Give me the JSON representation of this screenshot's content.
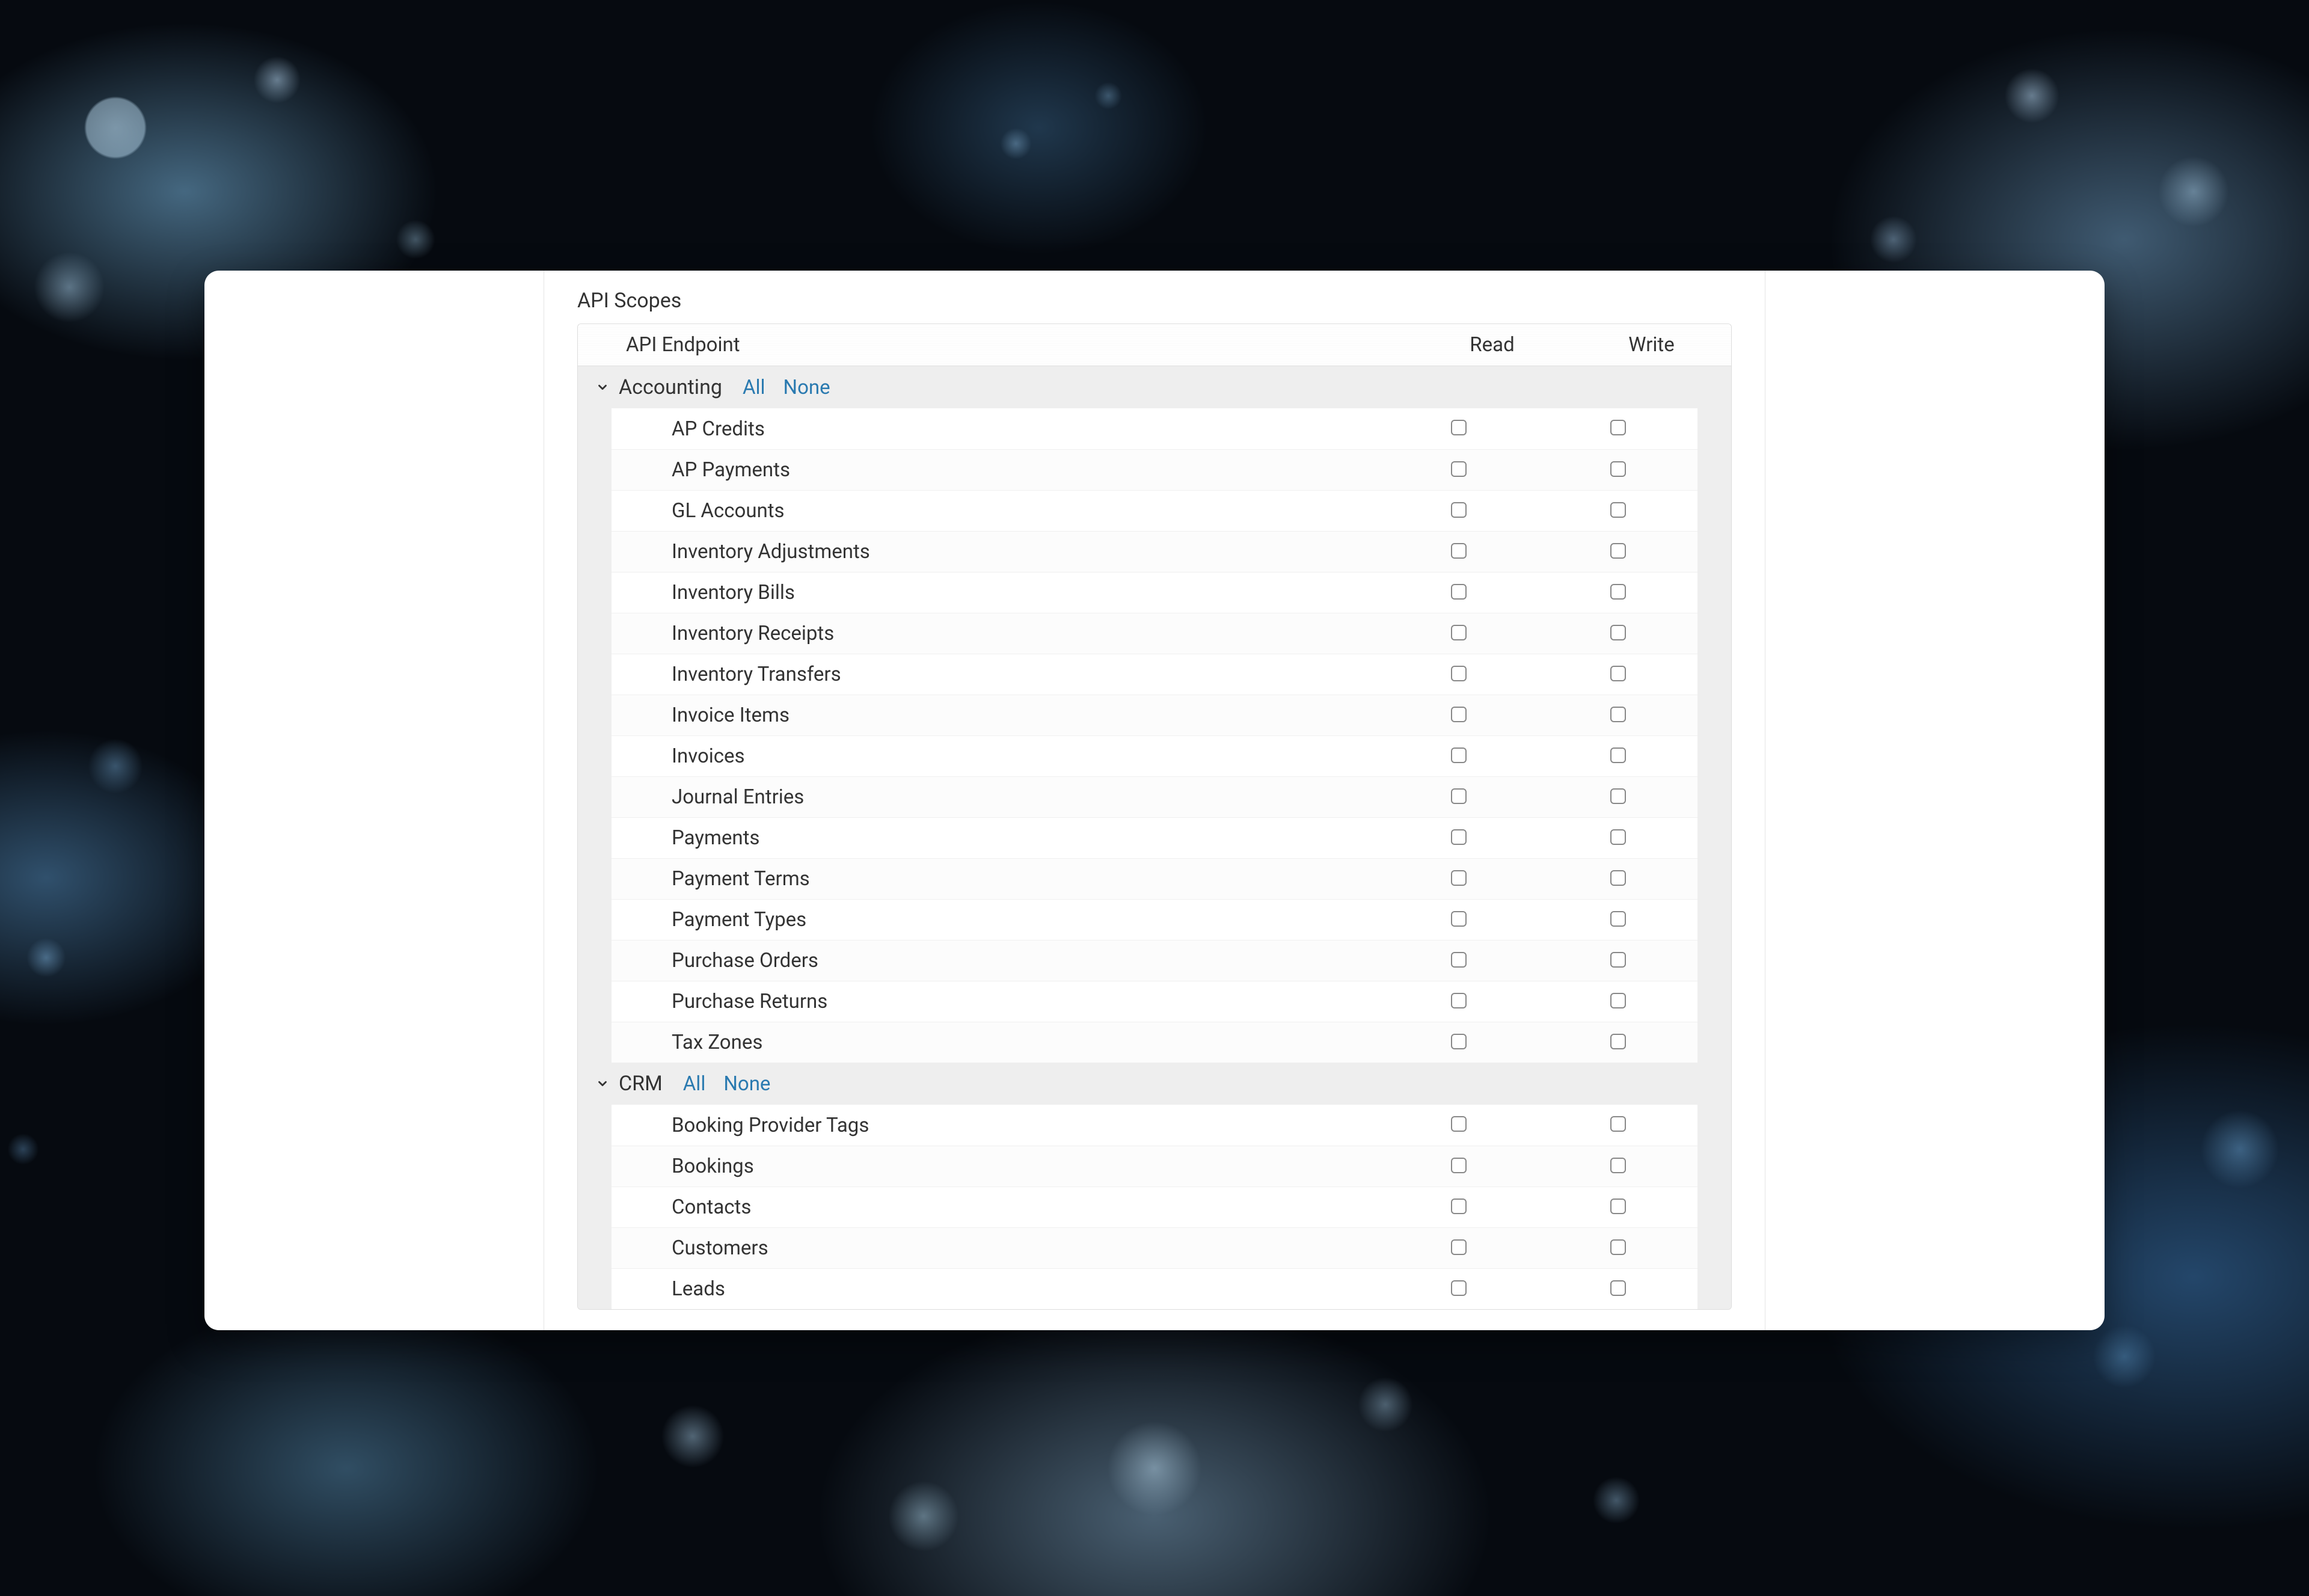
{
  "section_title": "API Scopes",
  "columns": {
    "endpoint": "API Endpoint",
    "read": "Read",
    "write": "Write"
  },
  "link_all": "All",
  "link_none": "None",
  "groups": [
    {
      "name": "Accounting",
      "expanded": true,
      "items": [
        {
          "label": "AP Credits",
          "read": false,
          "write": false
        },
        {
          "label": "AP Payments",
          "read": false,
          "write": false
        },
        {
          "label": "GL Accounts",
          "read": false,
          "write": false
        },
        {
          "label": "Inventory Adjustments",
          "read": false,
          "write": false
        },
        {
          "label": "Inventory Bills",
          "read": false,
          "write": false
        },
        {
          "label": "Inventory Receipts",
          "read": false,
          "write": false
        },
        {
          "label": "Inventory Transfers",
          "read": false,
          "write": false
        },
        {
          "label": "Invoice Items",
          "read": false,
          "write": false
        },
        {
          "label": "Invoices",
          "read": false,
          "write": false
        },
        {
          "label": "Journal Entries",
          "read": false,
          "write": false
        },
        {
          "label": "Payments",
          "read": false,
          "write": false
        },
        {
          "label": "Payment Terms",
          "read": false,
          "write": false
        },
        {
          "label": "Payment Types",
          "read": false,
          "write": false
        },
        {
          "label": "Purchase Orders",
          "read": false,
          "write": false
        },
        {
          "label": "Purchase Returns",
          "read": false,
          "write": false
        },
        {
          "label": "Tax Zones",
          "read": false,
          "write": false
        }
      ]
    },
    {
      "name": "CRM",
      "expanded": true,
      "items": [
        {
          "label": "Booking Provider Tags",
          "read": false,
          "write": false
        },
        {
          "label": "Bookings",
          "read": false,
          "write": false
        },
        {
          "label": "Contacts",
          "read": false,
          "write": false
        },
        {
          "label": "Customers",
          "read": false,
          "write": false
        },
        {
          "label": "Leads",
          "read": false,
          "write": false
        }
      ]
    }
  ]
}
